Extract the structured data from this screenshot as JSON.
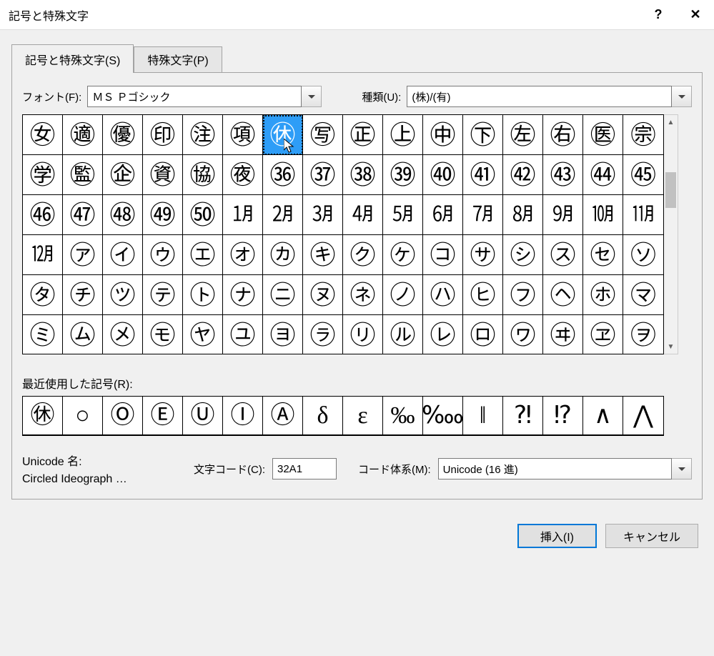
{
  "title": "記号と特殊文字",
  "tabs": {
    "symbols": "記号と特殊文字(S)",
    "special": "特殊文字(P)"
  },
  "labels": {
    "font": "フォント(F):",
    "subset": "種類(U):",
    "recent": "最近使用した記号(R):",
    "unicode_name_title": "Unicode 名:",
    "char_code": "文字コード(C):",
    "from": "コード体系(M):"
  },
  "values": {
    "font": "ＭＳ Ｐゴシック",
    "subset": "(株)/(有)",
    "unicode_name": "Circled Ideograph …",
    "char_code": "32A1",
    "from": "Unicode (16 進)"
  },
  "buttons": {
    "insert": "挿入(I)",
    "cancel": "キャンセル",
    "help": "?",
    "close": "✕"
  },
  "grid_selected": 6,
  "grid": [
    "㊛",
    "㊜",
    "㊝",
    "㊞",
    "㊟",
    "㊠",
    "㊡",
    "㊢",
    "㊣",
    "㊤",
    "㊥",
    "㊦",
    "㊧",
    "㊨",
    "㊩",
    "㊪",
    "㊫",
    "㊬",
    "㊭",
    "㊮",
    "㊯",
    "㊰",
    "㊱",
    "㊲",
    "㊳",
    "㊴",
    "㊵",
    "㊶",
    "㊷",
    "㊸",
    "㊹",
    "㊺",
    "㊻",
    "㊼",
    "㊽",
    "㊾",
    "㊿",
    "㋀",
    "㋁",
    "㋂",
    "㋃",
    "㋄",
    "㋅",
    "㋆",
    "㋇",
    "㋈",
    "㋉",
    "㋊",
    "㋋",
    "㋐",
    "㋑",
    "㋒",
    "㋓",
    "㋔",
    "㋕",
    "㋖",
    "㋗",
    "㋘",
    "㋙",
    "㋚",
    "㋛",
    "㋜",
    "㋝",
    "㋞",
    "㋟",
    "㋠",
    "㋡",
    "㋢",
    "㋣",
    "㋤",
    "㋥",
    "㋦",
    "㋧",
    "㋨",
    "㋩",
    "㋪",
    "㋫",
    "㋬",
    "㋭",
    "㋮",
    "㋯",
    "㋰",
    "㋱",
    "㋲",
    "㋳",
    "㋴",
    "㋵",
    "㋶",
    "㋷",
    "㋸",
    "㋹",
    "㋺",
    "㋻",
    "㋼",
    "㋽",
    "㋾"
  ],
  "grid_small_indices": [
    37,
    38,
    39,
    40,
    41,
    42,
    43,
    44,
    45,
    46,
    47,
    48
  ],
  "recent": [
    "㊡",
    "○",
    "Ⓞ",
    "Ⓔ",
    "Ⓤ",
    "Ⓘ",
    "Ⓐ",
    "δ",
    "ε",
    "‰",
    "‱",
    "‖",
    "⁈",
    "⁉",
    "∧",
    "⋀"
  ]
}
